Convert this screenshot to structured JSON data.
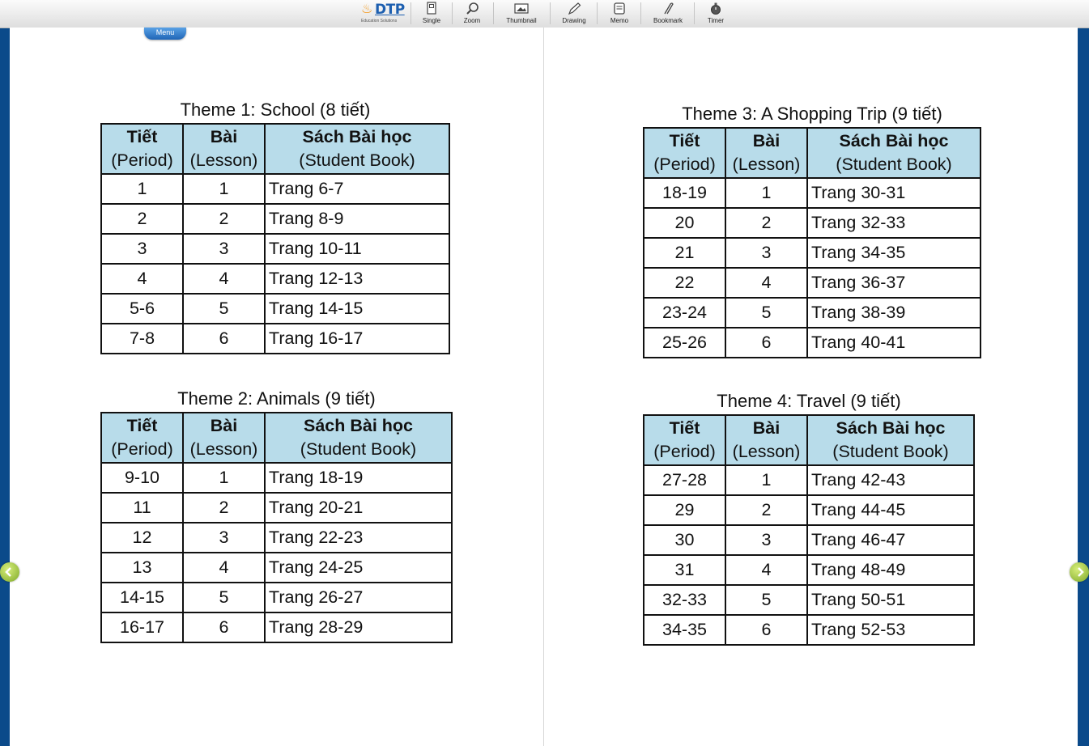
{
  "toolbar": {
    "logo_text": "DTP",
    "logo_sub": "Education Solutions",
    "tools": [
      {
        "label": "Single",
        "icon": "single-page-icon"
      },
      {
        "label": "Zoom",
        "icon": "zoom-icon"
      },
      {
        "label": "Thumbnail",
        "icon": "thumbnail-icon"
      },
      {
        "label": "Drawing",
        "icon": "drawing-icon"
      },
      {
        "label": "Memo",
        "icon": "memo-icon"
      },
      {
        "label": "Bookmark",
        "icon": "bookmark-icon"
      },
      {
        "label": "Timer",
        "icon": "timer-icon"
      }
    ]
  },
  "menu_label": "Menu",
  "header": {
    "period_vi": "Tiết",
    "period_en": "(Period)",
    "lesson_vi": "Bài",
    "lesson_en": "(Lesson)",
    "book_vi": "Sách Bài học",
    "book_en": "(Student Book)"
  },
  "themes": [
    {
      "title": "Theme 1: School (8 tiết)",
      "rows": [
        {
          "period": "1",
          "lesson": "1",
          "book": "Trang 6-7"
        },
        {
          "period": "2",
          "lesson": "2",
          "book": "Trang 8-9"
        },
        {
          "period": "3",
          "lesson": "3",
          "book": "Trang 10-11"
        },
        {
          "period": "4",
          "lesson": "4",
          "book": "Trang 12-13"
        },
        {
          "period": "5-6",
          "lesson": "5",
          "book": "Trang 14-15"
        },
        {
          "period": "7-8",
          "lesson": "6",
          "book": "Trang 16-17"
        }
      ]
    },
    {
      "title": "Theme 2: Animals (9 tiết)",
      "rows": [
        {
          "period": "9-10",
          "lesson": "1",
          "book": "Trang 18-19"
        },
        {
          "period": "11",
          "lesson": "2",
          "book": "Trang 20-21"
        },
        {
          "period": "12",
          "lesson": "3",
          "book": "Trang 22-23"
        },
        {
          "period": "13",
          "lesson": "4",
          "book": "Trang 24-25"
        },
        {
          "period": "14-15",
          "lesson": "5",
          "book": "Trang 26-27"
        },
        {
          "period": "16-17",
          "lesson": "6",
          "book": "Trang 28-29"
        }
      ]
    },
    {
      "title": "Theme 3: A Shopping Trip (9 tiết)",
      "rows": [
        {
          "period": "18-19",
          "lesson": "1",
          "book": "Trang 30-31"
        },
        {
          "period": "20",
          "lesson": "2",
          "book": "Trang 32-33"
        },
        {
          "period": "21",
          "lesson": "3",
          "book": "Trang 34-35"
        },
        {
          "period": "22",
          "lesson": "4",
          "book": "Trang 36-37"
        },
        {
          "period": "23-24",
          "lesson": "5",
          "book": "Trang 38-39"
        },
        {
          "period": "25-26",
          "lesson": "6",
          "book": "Trang 40-41"
        }
      ]
    },
    {
      "title": "Theme 4: Travel (9 tiết)",
      "rows": [
        {
          "period": "27-28",
          "lesson": "1",
          "book": "Trang 42-43"
        },
        {
          "period": "29",
          "lesson": "2",
          "book": "Trang 44-45"
        },
        {
          "period": "30",
          "lesson": "3",
          "book": "Trang 46-47"
        },
        {
          "period": "31",
          "lesson": "4",
          "book": "Trang 48-49"
        },
        {
          "period": "32-33",
          "lesson": "5",
          "book": "Trang 50-51"
        },
        {
          "period": "34-35",
          "lesson": "6",
          "book": "Trang 52-53"
        }
      ]
    }
  ],
  "colors": {
    "header_fill": "#b8dcea",
    "frame_blue": "#0b4a8a",
    "menu_tab": "#2a73c4",
    "nav_arrow": "#9cc23a"
  },
  "nav": {
    "prev_icon": "chevron-left-icon",
    "next_icon": "chevron-right-icon"
  }
}
